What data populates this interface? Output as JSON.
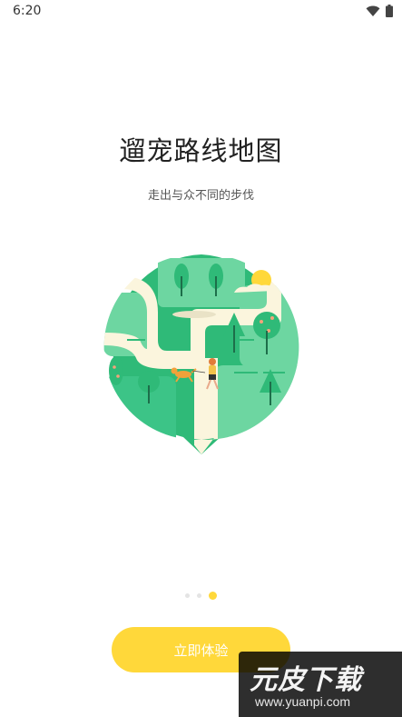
{
  "status_bar": {
    "time": "6:20",
    "icons": [
      "wifi-icon",
      "battery-icon"
    ]
  },
  "onboarding": {
    "title": "遛宠路线地图",
    "subtitle": "走出与众不同的步伐",
    "page_count": 3,
    "active_page": 3,
    "cta_label": "立即体验"
  },
  "watermark": {
    "main": "元皮下载",
    "url": "www.yuanpi.com"
  },
  "colors": {
    "accent": "#ffd83a",
    "green_dark": "#2fba78",
    "green_light": "#6dd6a1",
    "path": "#fbf5dd"
  }
}
